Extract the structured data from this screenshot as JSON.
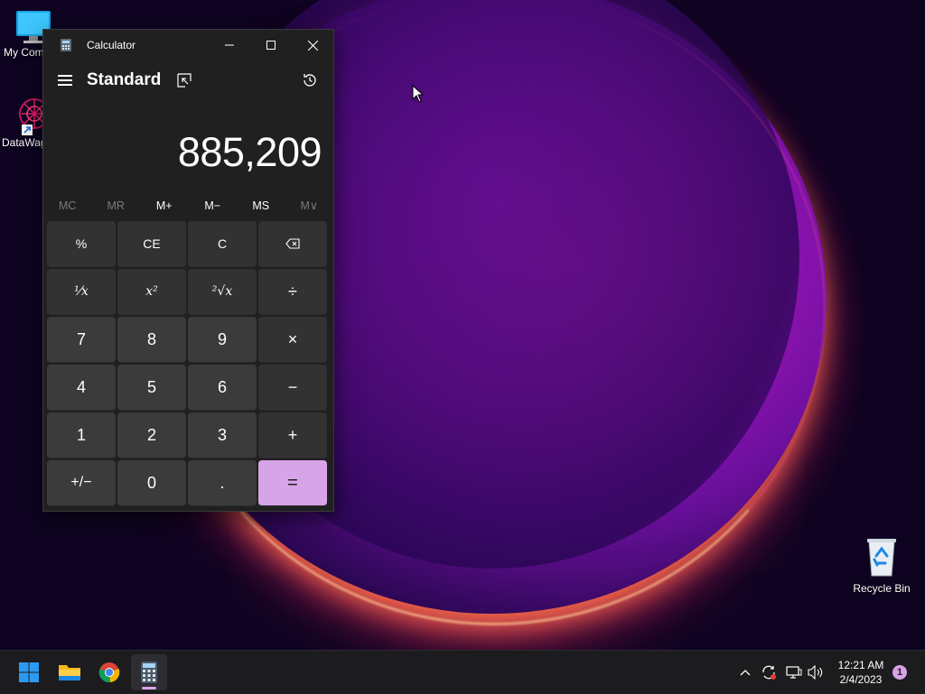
{
  "desktop": {
    "icons": [
      {
        "label": "My Com",
        "icon": "monitor-icon"
      },
      {
        "label": "DataWag",
        "icon": "datawagon-shortcut-icon"
      },
      {
        "label": "Recycle Bin",
        "icon": "recycle-bin-icon"
      }
    ]
  },
  "calculator": {
    "window_title": "Calculator",
    "mode": "Standard",
    "display_value": "885,209",
    "memory_buttons": [
      "MC",
      "MR",
      "M+",
      "M−",
      "MS",
      "M∨"
    ],
    "keys": [
      [
        "%",
        "CE",
        "C",
        "⌫"
      ],
      [
        "¹⁄x",
        "x²",
        "²√x",
        "÷"
      ],
      [
        "7",
        "8",
        "9",
        "×"
      ],
      [
        "4",
        "5",
        "6",
        "−"
      ],
      [
        "1",
        "2",
        "3",
        "+"
      ],
      [
        "+/−",
        "0",
        ".",
        "="
      ]
    ],
    "equals_color": "#d7a4e8"
  },
  "taskbar": {
    "apps": [
      "start-icon",
      "file-explorer-icon",
      "chrome-icon",
      "calculator-icon"
    ],
    "tray_icons": [
      "chevron-up-icon",
      "sync-icon",
      "network-icon",
      "volume-icon"
    ],
    "time": "12:21 AM",
    "date": "2/4/2023",
    "notification_count": "1"
  }
}
